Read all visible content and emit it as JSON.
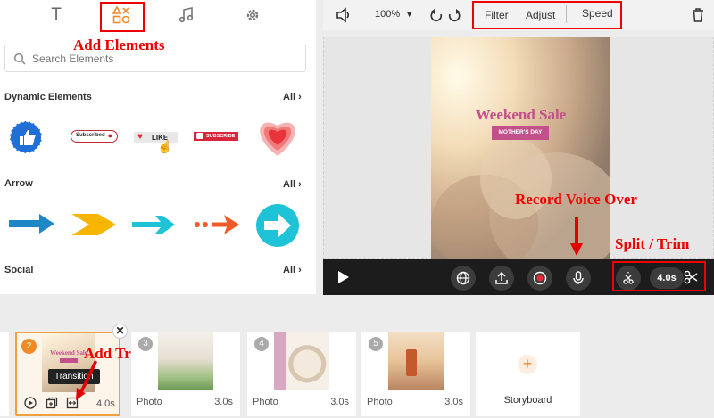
{
  "tabs": {
    "text_icon": "T",
    "elements_icon": "elements-icon",
    "music_icon": "music-icon",
    "settings_icon": "gear-icon"
  },
  "annotations": {
    "add_elements": "Add Elements",
    "record_voice_over": "Record Voice Over",
    "split_trim": "Split / Trim",
    "add_transition": "Add Transition"
  },
  "search": {
    "placeholder": "Search Elements"
  },
  "sections": {
    "dynamic": {
      "title": "Dynamic Elements",
      "all": "All"
    },
    "arrow": {
      "title": "Arrow",
      "all": "All"
    },
    "social": {
      "title": "Social",
      "all": "All"
    }
  },
  "dynamic_items": {
    "subscribed": "Subscribed",
    "like": "LIKE",
    "subscribe": "SUBSCRIBE"
  },
  "toolbar": {
    "zoom": "100%",
    "filter": "Filter",
    "adjust": "Adjust",
    "speed": "Speed"
  },
  "preview": {
    "headline": "Weekend Sale",
    "subline": "MOTHER'S DAY"
  },
  "player": {
    "duration": "4.0s"
  },
  "storyboard": {
    "active_tooltip": "Transition",
    "active_duration": "4.0s",
    "active_number": "2",
    "active_thumb_title": "Weekend Sale",
    "slides": [
      {
        "number": "3",
        "name": "Photo",
        "duration": "3.0s"
      },
      {
        "number": "4",
        "name": "Photo",
        "duration": "3.0s"
      },
      {
        "number": "5",
        "name": "Photo",
        "duration": "3.0s"
      }
    ],
    "add_label": "Storyboard"
  },
  "colors": {
    "accent": "#f08a24",
    "annotation_red": "#e00000",
    "pink": "#c2508a",
    "arrow_blue": "#1e88c7",
    "arrow_yellow": "#f7b500",
    "arrow_cyan": "#1ec3d8",
    "arrow_orange": "#f05a28"
  }
}
